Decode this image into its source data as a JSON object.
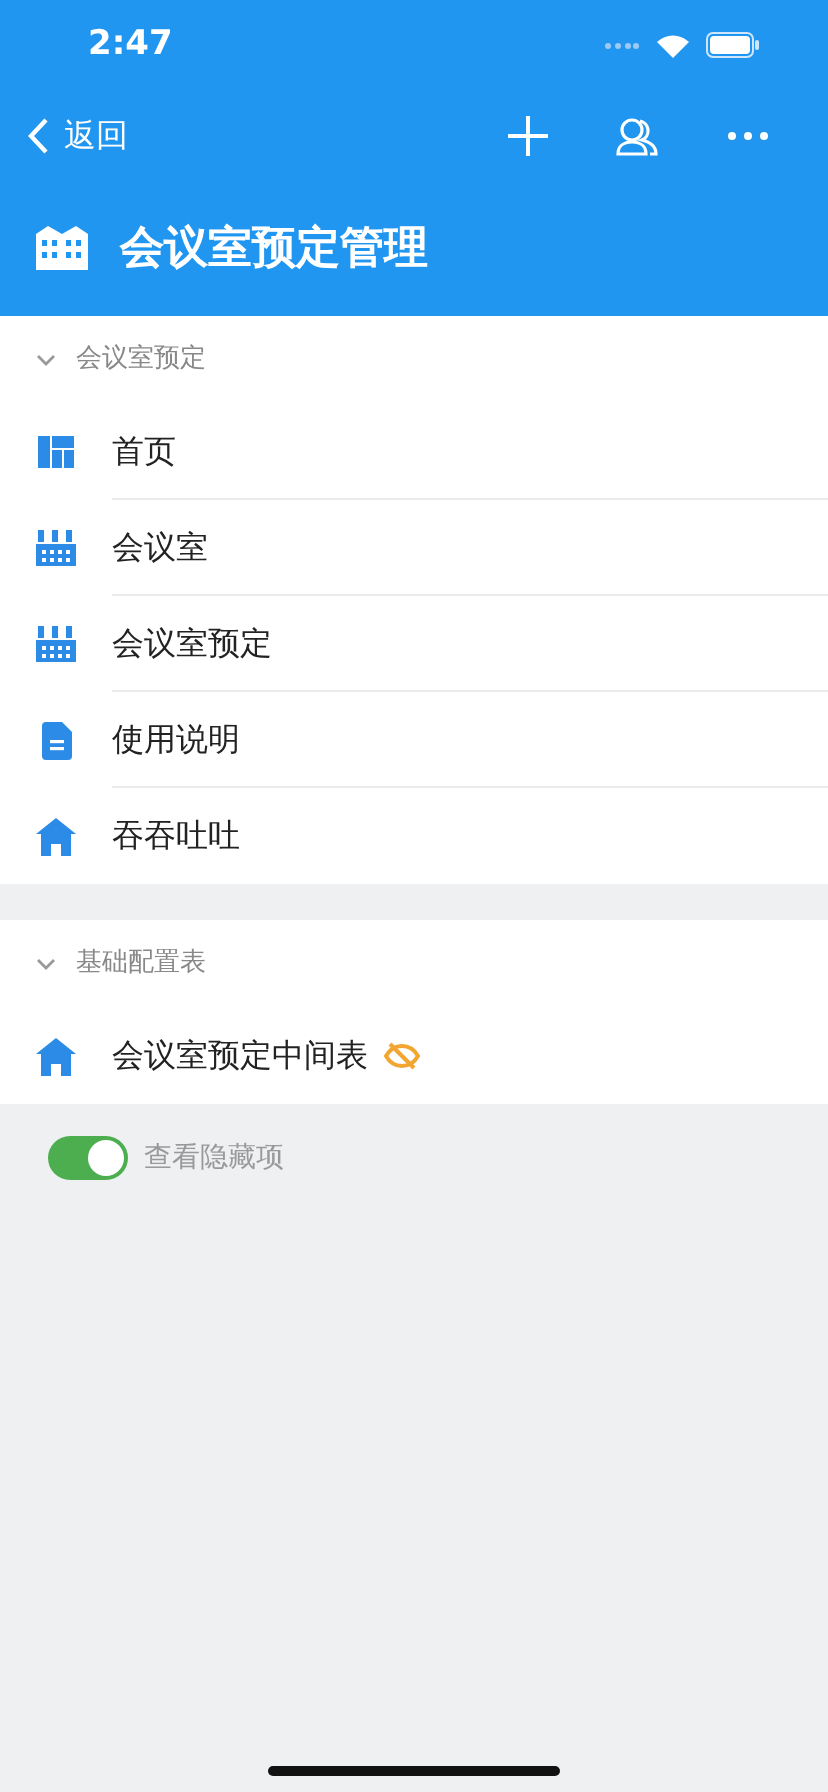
{
  "status_bar": {
    "time": "2:47"
  },
  "nav": {
    "back_label": "返回"
  },
  "header": {
    "title": "会议室预定管理"
  },
  "sections": [
    {
      "title": "会议室预定",
      "expanded": true,
      "items": [
        {
          "label": "首页",
          "kind": "dashboard",
          "hidden": false
        },
        {
          "label": "会议室",
          "kind": "factory",
          "hidden": false
        },
        {
          "label": "会议室预定",
          "kind": "factory",
          "hidden": false
        },
        {
          "label": "使用说明",
          "kind": "document",
          "hidden": false
        },
        {
          "label": "吞吞吐吐",
          "kind": "house",
          "hidden": false
        }
      ]
    },
    {
      "title": "基础配置表",
      "expanded": true,
      "items": [
        {
          "label": "会议室预定中间表",
          "kind": "house",
          "hidden": true
        }
      ]
    }
  ],
  "show_hidden": {
    "label": "查看隐藏项",
    "on": true
  }
}
